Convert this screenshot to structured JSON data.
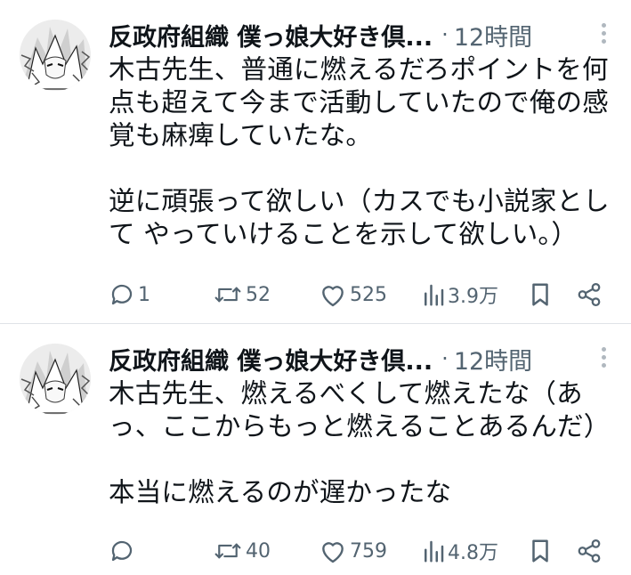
{
  "tweets": [
    {
      "author_name": "反政府組織 僕っ娘大好き倶...",
      "separator": "·",
      "time": "12時間",
      "text": "木古先生、普通に燃えるだろポイントを何点も超えて今まで活動していたので俺の感覚も麻痺していたな。\n\n逆に頑張って欲しい（カスでも小説家として やっていけることを示して欲しい。）",
      "actions": {
        "replies": "1",
        "retweets": "52",
        "likes": "525",
        "views": "3.9万"
      }
    },
    {
      "author_name": "反政府組織 僕っ娘大好き倶...",
      "separator": "·",
      "time": "12時間",
      "text": "木古先生、燃えるべくして燃えたな（あっ、ここからもっと燃えることあるんだ）\n\n本当に燃えるのが遅かったな",
      "actions": {
        "replies": "",
        "retweets": "40",
        "likes": "759",
        "views": "4.8万"
      }
    }
  ],
  "icons": [
    "reply-icon",
    "retweet-icon",
    "like-icon",
    "views-icon",
    "bookmark-icon",
    "share-icon",
    "more-icon"
  ],
  "colors": {
    "text": "#0f1419",
    "secondary": "#536471",
    "divider": "#dfe3e7"
  }
}
